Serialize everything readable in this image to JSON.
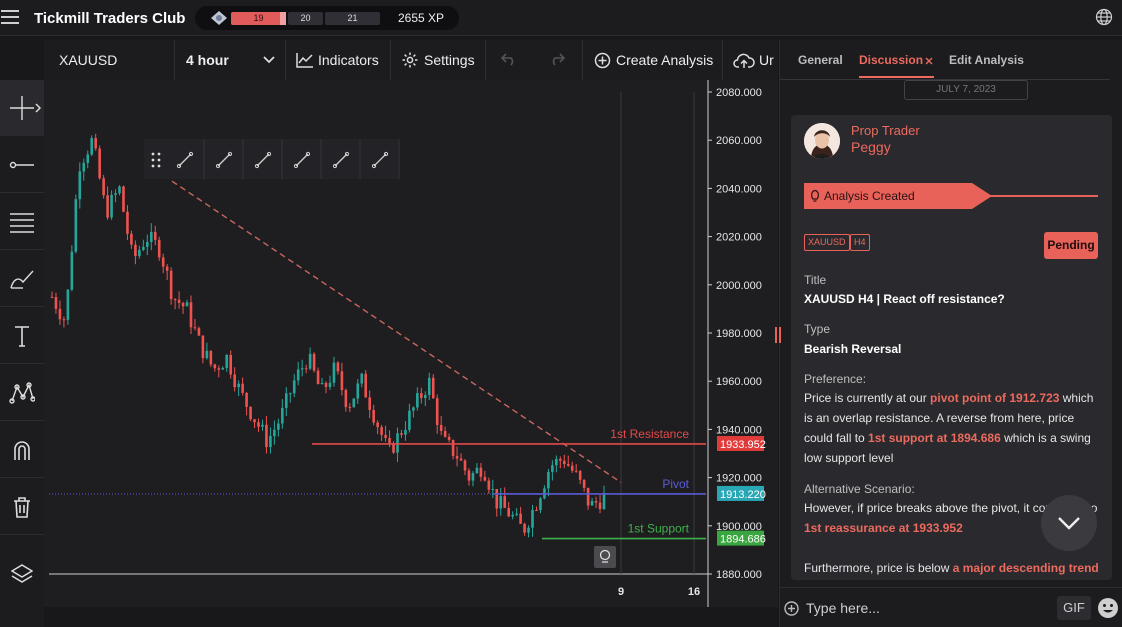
{
  "app": {
    "title": "Tickmill Traders Club",
    "xp_text": "2655 XP",
    "levels": [
      "19",
      "20",
      "21"
    ]
  },
  "toolbar": {
    "symbol": "XAUUSD",
    "interval": "4 hour",
    "indicators": "Indicators",
    "settings": "Settings",
    "create_analysis": "Create Analysis",
    "upload": "Ur"
  },
  "chart_data": {
    "type": "candlestick",
    "symbol": "XAUUSD",
    "interval": "4 hour",
    "y_ticks": [
      "2080.000",
      "2060.000",
      "2040.000",
      "2020.000",
      "2000.000",
      "1980.000",
      "1960.000",
      "1940.000",
      "1920.000",
      "1900.000",
      "1880.000"
    ],
    "ylim": [
      1880,
      2080
    ],
    "x_ticks": [
      "9",
      "16"
    ],
    "levels": [
      {
        "name": "1st Resistance",
        "price": 1933.952,
        "label": "1933.952",
        "color": "#e24a4a"
      },
      {
        "name": "Pivot",
        "price": 1913.22,
        "label": "1913.220",
        "color": "#5b5bd6"
      },
      {
        "name": "1st Support",
        "price": 1894.686,
        "label": "1894.686",
        "color": "#3fb04a"
      }
    ],
    "trendline": {
      "from": {
        "x": "about 8 bars after start",
        "y": 2043
      },
      "to": {
        "x": "near 9",
        "y": 1918
      },
      "style": "dashed",
      "color": "#c8665e"
    },
    "approx_path": [
      1995,
      1985,
      2050,
      2060,
      2030,
      2040,
      2010,
      2020,
      2015,
      1995,
      1990,
      1975,
      1965,
      1970,
      1955,
      1945,
      1935,
      1945,
      1960,
      1970,
      1955,
      1965,
      1950,
      1960,
      1945,
      1930,
      1940,
      1950,
      1960,
      1935,
      1930,
      1920,
      1925,
      1910,
      1905,
      1898,
      1910,
      1925,
      1928,
      1920,
      1908,
      1912
    ]
  },
  "side": {
    "tabs": [
      "General",
      "Discussion",
      "Edit Analysis"
    ],
    "date": "JULY 7, 2023",
    "role": "Prop Trader",
    "author": "Peggy",
    "banner": "Analysis Created",
    "tags": [
      "XAUUSD",
      "H4"
    ],
    "status": "Pending",
    "title_label": "Title",
    "title_value": "XAUUSD H4 | React off resistance?",
    "type_label": "Type",
    "type_value": "Bearish Reversal",
    "pref_label": "Preference:",
    "pref_text_1": "Price is currently at our ",
    "pref_hl_1": "pivot point of 1912.723",
    "pref_text_2": " which is an overlap resistance. A reverse from here, price could fall to ",
    "pref_hl_2": "1st support at 1894.686",
    "pref_text_3": " which is a swing low support level",
    "alt_label": "Alternative Scenario:",
    "alt_text_1": "However, if price breaks above the pivot, it could rise to ",
    "alt_hl_1": "1st reassurance at 1933.952",
    "further_text": "Furthermore,  price is below ",
    "further_hl": "a major descending trend",
    "composer_placeholder": "Type here...",
    "gif": "GIF"
  }
}
